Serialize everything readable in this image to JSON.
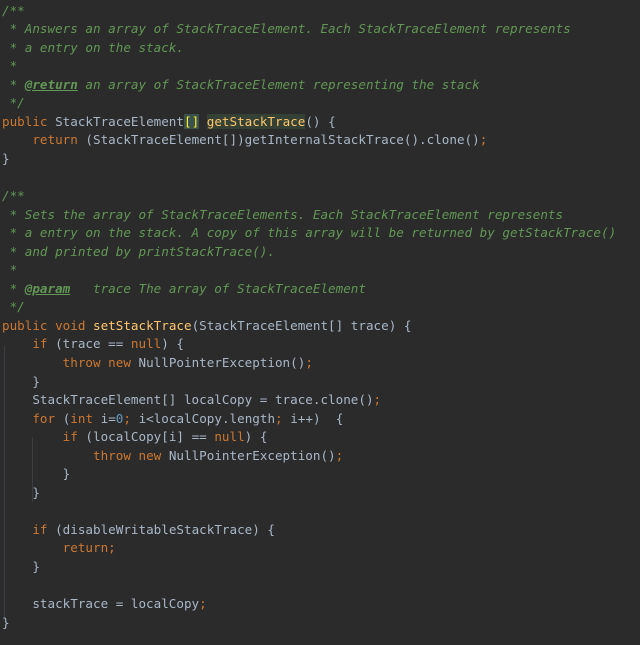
{
  "editor": {
    "caret_line": 6,
    "lines": [
      {
        "row": 0,
        "tokens": [
          {
            "t": "/**",
            "c": "doc"
          }
        ]
      },
      {
        "row": 1,
        "tokens": [
          {
            "t": " * Answers an array of StackTraceElement. Each StackTraceElement represents",
            "c": "doc"
          }
        ]
      },
      {
        "row": 2,
        "tokens": [
          {
            "t": " * a entry on the stack.",
            "c": "doc"
          }
        ]
      },
      {
        "row": 3,
        "tokens": [
          {
            "t": " *",
            "c": "doc"
          }
        ]
      },
      {
        "row": 4,
        "tokens": [
          {
            "t": " * ",
            "c": "doc"
          },
          {
            "t": "@return",
            "c": "doctag"
          },
          {
            "t": " an array of StackTraceElement representing the stack",
            "c": "doc"
          }
        ]
      },
      {
        "row": 5,
        "tokens": [
          {
            "t": " */",
            "c": "doc"
          }
        ]
      },
      {
        "row": 6,
        "tokens": [
          {
            "t": "public ",
            "c": "kw"
          },
          {
            "t": "StackTraceElement",
            "c": "plain"
          },
          {
            "t": "[]",
            "c": "bracket-hl"
          },
          {
            "t": " ",
            "c": "plain"
          },
          {
            "t": "",
            "c": "caret"
          },
          {
            "t": "getStackTrace",
            "c": "fn caret-hl"
          },
          {
            "t": "() {",
            "c": "plain"
          }
        ]
      },
      {
        "row": 7,
        "tokens": [
          {
            "t": "    ",
            "c": "plain"
          },
          {
            "t": "return ",
            "c": "kw"
          },
          {
            "t": "(StackTraceElement[])getInternalStackTrace().clone()",
            "c": "plain"
          },
          {
            "t": ";",
            "c": "kw"
          }
        ]
      },
      {
        "row": 8,
        "tokens": [
          {
            "t": "}",
            "c": "plain"
          }
        ]
      },
      {
        "row": 9,
        "tokens": []
      },
      {
        "row": 10,
        "tokens": [
          {
            "t": "/**",
            "c": "doc"
          }
        ]
      },
      {
        "row": 11,
        "tokens": [
          {
            "t": " * Sets the array of StackTraceElements. Each StackTraceElement represents",
            "c": "doc"
          }
        ]
      },
      {
        "row": 12,
        "tokens": [
          {
            "t": " * a entry on the stack. A copy of this array will be returned by getStackTrace()",
            "c": "doc"
          }
        ]
      },
      {
        "row": 13,
        "tokens": [
          {
            "t": " * and printed by printStackTrace().",
            "c": "doc"
          }
        ]
      },
      {
        "row": 14,
        "tokens": [
          {
            "t": " *",
            "c": "doc"
          }
        ]
      },
      {
        "row": 15,
        "tokens": [
          {
            "t": " * ",
            "c": "doc"
          },
          {
            "t": "@param",
            "c": "doctag"
          },
          {
            "t": "   trace The array of StackTraceElement",
            "c": "doc"
          }
        ]
      },
      {
        "row": 16,
        "tokens": [
          {
            "t": " */",
            "c": "doc"
          }
        ]
      },
      {
        "row": 17,
        "tokens": [
          {
            "t": "public void ",
            "c": "kw"
          },
          {
            "t": "setStackTrace",
            "c": "fn"
          },
          {
            "t": "(StackTraceElement[] trace) {",
            "c": "plain"
          }
        ]
      },
      {
        "row": 18,
        "tokens": [
          {
            "t": "    ",
            "c": "plain"
          },
          {
            "t": "if ",
            "c": "kw"
          },
          {
            "t": "(trace == ",
            "c": "plain"
          },
          {
            "t": "null",
            "c": "kw"
          },
          {
            "t": ") {",
            "c": "plain"
          }
        ]
      },
      {
        "row": 19,
        "tokens": [
          {
            "t": "        ",
            "c": "plain"
          },
          {
            "t": "throw new ",
            "c": "kw"
          },
          {
            "t": "NullPointerException()",
            "c": "plain"
          },
          {
            "t": ";",
            "c": "kw"
          }
        ]
      },
      {
        "row": 20,
        "tokens": [
          {
            "t": "    }",
            "c": "plain"
          }
        ]
      },
      {
        "row": 21,
        "tokens": [
          {
            "t": "    StackTraceElement[] localCopy = trace.clone()",
            "c": "plain"
          },
          {
            "t": ";",
            "c": "kw"
          }
        ]
      },
      {
        "row": 22,
        "tokens": [
          {
            "t": "    ",
            "c": "plain"
          },
          {
            "t": "for ",
            "c": "kw"
          },
          {
            "t": "(",
            "c": "plain"
          },
          {
            "t": "int ",
            "c": "kw"
          },
          {
            "t": "i=",
            "c": "plain"
          },
          {
            "t": "0",
            "c": "num"
          },
          {
            "t": "; ",
            "c": "kw"
          },
          {
            "t": "i<localCopy.length",
            "c": "plain"
          },
          {
            "t": "; ",
            "c": "kw"
          },
          {
            "t": "i++)  {",
            "c": "plain"
          }
        ]
      },
      {
        "row": 23,
        "tokens": [
          {
            "t": "        ",
            "c": "plain"
          },
          {
            "t": "if ",
            "c": "kw"
          },
          {
            "t": "(localCopy[i] == ",
            "c": "plain"
          },
          {
            "t": "null",
            "c": "kw"
          },
          {
            "t": ") {",
            "c": "plain"
          }
        ]
      },
      {
        "row": 24,
        "tokens": [
          {
            "t": "            ",
            "c": "plain"
          },
          {
            "t": "throw new ",
            "c": "kw"
          },
          {
            "t": "NullPointerException()",
            "c": "plain"
          },
          {
            "t": ";",
            "c": "kw"
          }
        ]
      },
      {
        "row": 25,
        "tokens": [
          {
            "t": "        }",
            "c": "plain"
          }
        ]
      },
      {
        "row": 26,
        "tokens": [
          {
            "t": "    }",
            "c": "plain"
          }
        ]
      },
      {
        "row": 27,
        "tokens": []
      },
      {
        "row": 28,
        "tokens": [
          {
            "t": "    ",
            "c": "plain"
          },
          {
            "t": "if ",
            "c": "kw"
          },
          {
            "t": "(disableWritableStackTrace) {",
            "c": "plain"
          }
        ]
      },
      {
        "row": 29,
        "tokens": [
          {
            "t": "        ",
            "c": "plain"
          },
          {
            "t": "return",
            "c": "kw"
          },
          {
            "t": ";",
            "c": "kw"
          }
        ]
      },
      {
        "row": 30,
        "tokens": [
          {
            "t": "    }",
            "c": "plain"
          }
        ]
      },
      {
        "row": 31,
        "tokens": []
      },
      {
        "row": 32,
        "tokens": [
          {
            "t": "    stackTrace = localCopy",
            "c": "plain"
          },
          {
            "t": ";",
            "c": "kw"
          }
        ]
      },
      {
        "row": 33,
        "tokens": [
          {
            "t": "}",
            "c": "plain"
          }
        ]
      }
    ]
  }
}
